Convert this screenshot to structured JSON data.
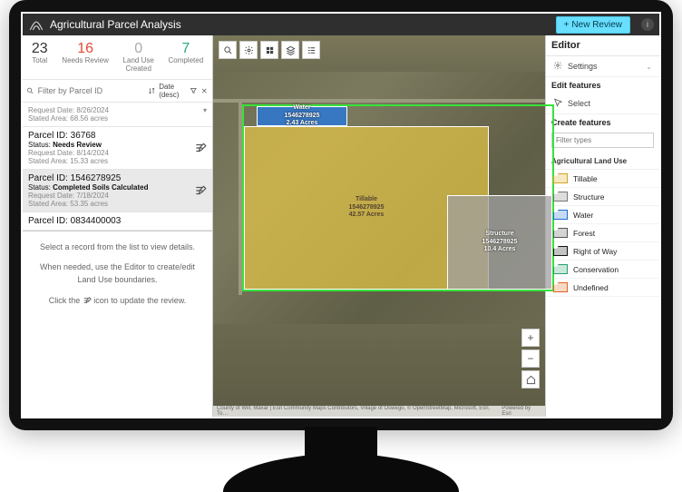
{
  "header": {
    "title": "Agricultural Parcel Analysis",
    "new_review_label": "New Review"
  },
  "stats": {
    "total": {
      "num": "23",
      "label": "Total"
    },
    "review": {
      "num": "16",
      "label": "Needs Review"
    },
    "landuse": {
      "num": "0",
      "label": "Land Use\nCreated"
    },
    "done": {
      "num": "7",
      "label": "Completed"
    }
  },
  "filter": {
    "placeholder": "Filter by Parcel ID",
    "sort_label": "Date (desc)"
  },
  "rows": {
    "stub": {
      "line1": "Request Date: 8/26/2024",
      "line2": "Stated Area: 68.56 acres"
    },
    "r1": {
      "pid": "Parcel ID: 36768",
      "status_prefix": "Status: ",
      "status": "Needs Review",
      "date": "Request Date: 8/14/2024",
      "area": "Stated Area: 15.33 acres"
    },
    "r2": {
      "pid": "Parcel ID: 1546278925",
      "status_prefix": "Status: ",
      "status": "Completed Soils Calculated",
      "date": "Request Date: 7/18/2024",
      "area": "Stated Area: 53.35 acres"
    },
    "r3": {
      "pid": "Parcel ID: 0834400003"
    }
  },
  "help": {
    "p1": "Select a record from the list to view details.",
    "p2": "When needed, use the Editor to create/edit Land Use boundaries.",
    "p3a": "Click the ",
    "p3b": " icon to update the review."
  },
  "map": {
    "polys": {
      "water": {
        "name": "Water",
        "id": "1546278925",
        "area": "2.43 Acres"
      },
      "till": {
        "name": "Tillable",
        "id": "1546278925",
        "area": "42.57 Acres"
      },
      "struct": {
        "name": "Structure",
        "id": "1546278925",
        "area": "10.4 Acres"
      }
    },
    "attrib_left": "County of Will, Maxar | Esri Community Maps Contributors, Village of Oswego, © OpenStreetMap, Microsoft, Esri, To…",
    "attrib_right": "Powered by Esri"
  },
  "editor": {
    "title": "Editor",
    "settings": "Settings",
    "edit_features": "Edit features",
    "select": "Select",
    "create_features": "Create features",
    "filter_types_ph": "Filter types",
    "group": "Agricultural Land Use",
    "features": {
      "tillable": "Tillable",
      "structure": "Structure",
      "water": "Water",
      "forest": "Forest",
      "row": "Right of Way",
      "conservation": "Conservation",
      "undefined": "Undefined"
    }
  }
}
